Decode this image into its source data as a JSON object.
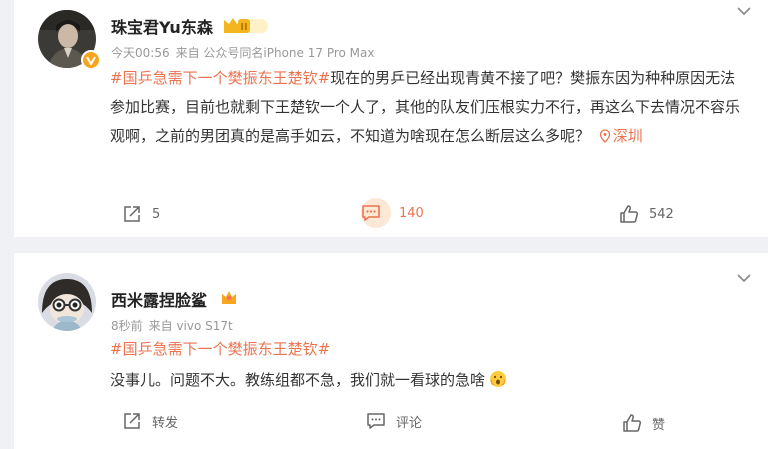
{
  "posts": [
    {
      "username": "珠宝君Yu东森",
      "level_badge": "II",
      "time": "今天00:56",
      "source": "来自 公众号同名iPhone 17 Pro Max",
      "topic": "#国乒急需下一个樊振东王楚钦#",
      "text": "现在的男乒已经出现青黄不接了吧？樊振东因为种种原因无法参加比赛，目前也就剩下王楚钦一个人了，其他的队友们压根实力不行，再这么下去情况不容乐观啊，之前的男团真的是高手如云，不知道为啥现在怎么断层这么多呢？",
      "location": "深圳",
      "repost_count": "5",
      "comment_count": "140",
      "like_count": "542"
    },
    {
      "username": "西米露捏脸鲨",
      "time": "8秒前",
      "source": "来自 vivo S17t",
      "topic": "#国乒急需下一个樊振东王楚钦#",
      "text": "没事儿。问题不大。教练组都不急，我们就一看球的急啥",
      "repost_label": "转发",
      "comment_label": "评论",
      "like_label": "赞"
    }
  ],
  "colors": {
    "accent": "#eb7350",
    "vip_gold": "#f7a41d",
    "bg": "#f0f1f4"
  },
  "icons": [
    "chevron-down-icon",
    "repost-icon",
    "comment-icon",
    "like-icon",
    "location-pin-icon",
    "vip-badge-icon",
    "crown-icon",
    "emoji-icon"
  ]
}
